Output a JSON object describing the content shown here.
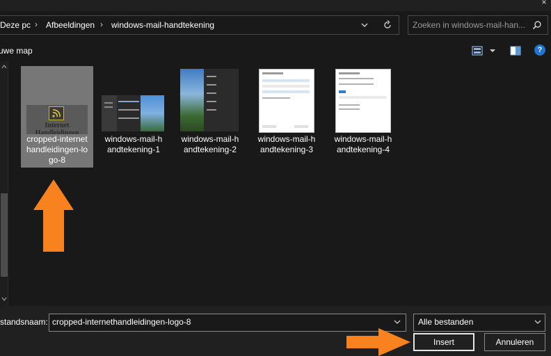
{
  "window": {
    "close_glyph": "×"
  },
  "breadcrumb": {
    "items": [
      "Deze pc",
      "Afbeeldingen",
      "windows-mail-handtekening"
    ],
    "separator": "›"
  },
  "search": {
    "placeholder": "Zoeken in windows-mail-han..."
  },
  "toolbar": {
    "new_folder_label": "uwe map",
    "help_glyph": "?"
  },
  "files": [
    {
      "name_line1": "cropped-internet",
      "name_line2": "handleidingen-lo",
      "name_line3": "go-8",
      "selected": true,
      "thumb_caption": "Internet Handleidingen",
      "thumb_icon": "rss-icon"
    },
    {
      "name_line1": "windows-mail-h",
      "name_line2": "andtekening-1",
      "name_line3": "",
      "selected": false
    },
    {
      "name_line1": "windows-mail-h",
      "name_line2": "andtekening-2",
      "name_line3": "",
      "selected": false
    },
    {
      "name_line1": "windows-mail-h",
      "name_line2": "andtekening-3",
      "name_line3": "",
      "selected": false
    },
    {
      "name_line1": "windows-mail-h",
      "name_line2": "andtekening-4",
      "name_line3": "",
      "selected": false
    }
  ],
  "footer": {
    "filename_label": "standsnaam:",
    "filename_value": "cropped-internethandleidingen-logo-8",
    "filetype_value": "Alle bestanden",
    "insert_label": "Insert",
    "cancel_label": "Annuleren"
  },
  "colors": {
    "background": "#191919",
    "selection": "#777777",
    "annotation_arrow": "#f7821e",
    "help_blue": "#1f73d1"
  }
}
